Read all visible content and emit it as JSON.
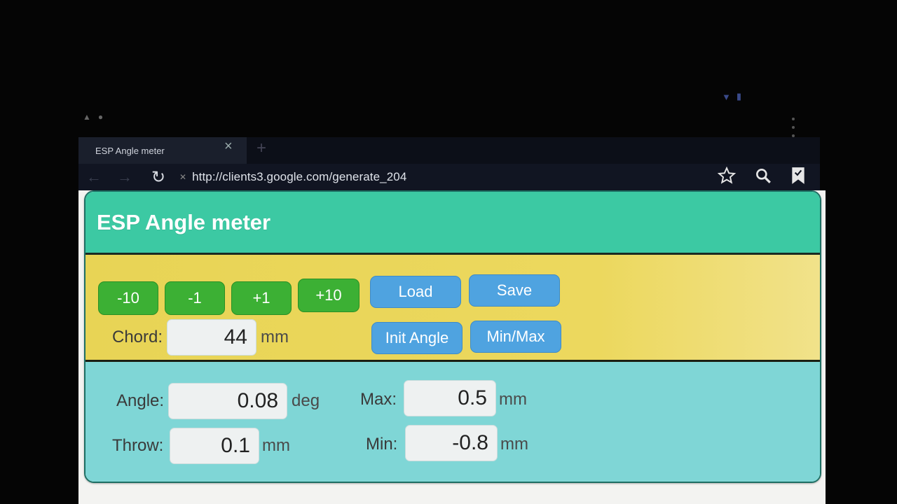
{
  "browser": {
    "tab_title": "ESP Angle meter",
    "tab_close": "×",
    "tab_new": "+",
    "url": "http://clients3.google.com/generate_204",
    "icons": [
      "back-icon",
      "forward-icon",
      "reload-icon",
      "site-info-icon",
      "star-icon",
      "search-icon",
      "bookmarks-icon",
      "overflow-menu-icon"
    ]
  },
  "app": {
    "title": "ESP Angle meter",
    "colors": {
      "header": "#3cc9a3",
      "controls": "#e8d455",
      "readings": "#7fd6d6",
      "green_button": "#3cb034",
      "blue_button": "#4fa3e0"
    },
    "step_buttons": [
      "-10",
      "-1",
      "+1",
      "+10"
    ],
    "load_label": "Load",
    "save_label": "Save",
    "init_angle_label": "Init Angle",
    "minmax_label": "Min/Max",
    "chord": {
      "label": "Chord:",
      "value": "44",
      "unit": "mm"
    },
    "angle": {
      "label": "Angle:",
      "value": "0.08",
      "unit": "deg"
    },
    "throw": {
      "label": "Throw:",
      "value": "0.1",
      "unit": "mm"
    },
    "max": {
      "label": "Max:",
      "value": "0.5",
      "unit": "mm"
    },
    "min": {
      "label": "Min:",
      "value": "-0.8",
      "unit": "mm"
    }
  }
}
